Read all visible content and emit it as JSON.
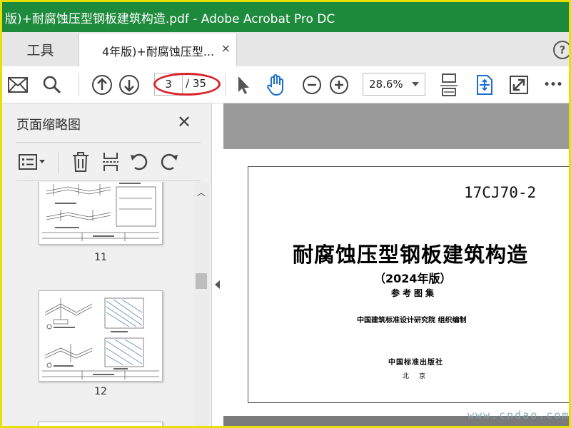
{
  "window": {
    "title": "版)+耐腐蚀压型钢板建筑构造.pdf - Adobe Acrobat Pro DC"
  },
  "tabs": {
    "tools_label": "工具",
    "doc_label": "4年版)+耐腐蚀压型...",
    "close_glyph": "×",
    "help_glyph": "?"
  },
  "toolbar": {
    "current_page": "3",
    "total_pages": "/ 35",
    "zoom": "28.6%",
    "more_glyph": "•••"
  },
  "sidebar": {
    "title": "页面缩略图",
    "close_glyph": "✕",
    "thumbnails": [
      {
        "label": "11"
      },
      {
        "label": "12"
      }
    ],
    "scroll_up_glyph": "︿"
  },
  "document": {
    "code": "17CJ70-2",
    "title": "耐腐蚀压型钢板建筑构造",
    "edition": "（2024年版）",
    "subtitle": "参考图集",
    "organizer": "中国建筑标准设计研究院  组织编制",
    "publisher": "中国标准出版社",
    "city": "北京"
  },
  "watermark": "www.cndao.com",
  "colors": {
    "titlebar": "#1e8a3c",
    "accent_oval": "#d9232a",
    "hand_tool": "#1a6fd1"
  }
}
